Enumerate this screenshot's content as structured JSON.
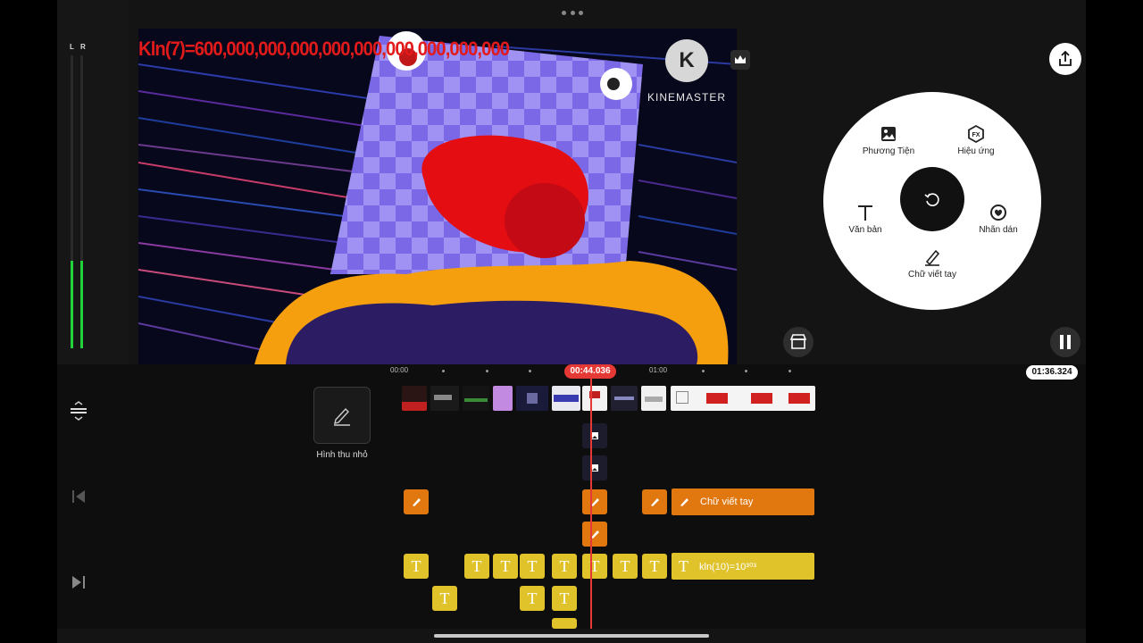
{
  "meter": {
    "left_label": "L",
    "right_label": "R",
    "left_level": 0.3,
    "right_level": 0.3
  },
  "preview": {
    "overlay_text": "Kln(7)=600,000,000,000,000,000,000,000,000,000",
    "brand": "KINEMASTER",
    "brand_initial": "K"
  },
  "icons": {
    "export": "share-icon",
    "premium": "crown-icon",
    "undo": "rotate-icon",
    "store": "store-icon",
    "pause": "pause-icon",
    "thumbnail": "pencil-icon",
    "adjust": "expand-vertical-icon",
    "prev": "skip-start-icon",
    "next": "skip-end-icon"
  },
  "wheel": {
    "media_label": "Phương Tiện",
    "effect_label": "Hiệu ứng",
    "text_label": "Văn bản",
    "sticker_label": "Nhãn dán",
    "handwriting_label": "Chữ viết tay",
    "effect_badge": "FX"
  },
  "timeline": {
    "thumbnail_label": "Hình thu nhỏ",
    "ruler_start": "00:00",
    "ruler_mid": "01:00",
    "playhead_time": "00:44.036",
    "total_time": "01:36.324",
    "handwriting_layer_label": "Chữ viết tay",
    "text_layer_label": "kln(10)=10³⁰³",
    "text_glyph": "T"
  },
  "colors": {
    "accent_red": "#e53935",
    "layer_orange": "#e0770f",
    "layer_yellow": "#e0c22b",
    "meter_green": "#22d23a"
  }
}
